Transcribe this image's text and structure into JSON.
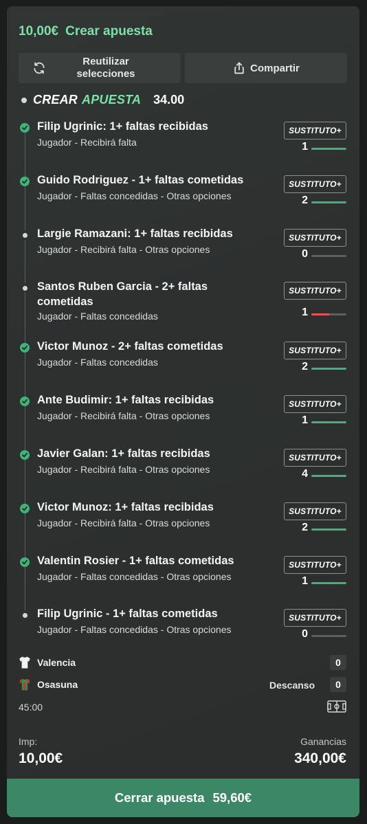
{
  "header": {
    "amount": "10,00€",
    "title": "Crear apuesta"
  },
  "actions": {
    "reuse_label_1": "Reutilizar",
    "reuse_label_2": "selecciones",
    "share_label": "Compartir"
  },
  "builder": {
    "title_part1": "CREAR",
    "title_part2": "APUESTA",
    "odds": "34.00"
  },
  "selections": [
    {
      "name": "Filip Ugrinic: 1+ faltas recibidas",
      "desc": "Jugador - Recibirá falta",
      "badge": "SUSTITUTO+",
      "count": "1",
      "progress": 1.0,
      "status": "won"
    },
    {
      "name": "Guido Rodriguez - 1+ faltas cometidas",
      "desc": "Jugador - Faltas concedidas - Otras opciones",
      "badge": "SUSTITUTO+",
      "count": "2",
      "progress": 1.0,
      "status": "won"
    },
    {
      "name": "Largie Ramazani: 1+ faltas recibidas",
      "desc": "Jugador - Recibirá falta - Otras opciones",
      "badge": "SUSTITUTO+",
      "count": "0",
      "progress": 0.0,
      "status": "pending"
    },
    {
      "name": "Santos Ruben Garcia - 2+ faltas cometidas",
      "desc": "Jugador - Faltas concedidas",
      "badge": "SUSTITUTO+",
      "count": "1",
      "progress": 0.5,
      "status": "pending"
    },
    {
      "name": "Victor Munoz - 2+ faltas cometidas",
      "desc": "Jugador - Faltas concedidas",
      "badge": "SUSTITUTO+",
      "count": "2",
      "progress": 1.0,
      "status": "won"
    },
    {
      "name": "Ante Budimir: 1+ faltas recibidas",
      "desc": "Jugador - Recibirá falta - Otras opciones",
      "badge": "SUSTITUTO+",
      "count": "1",
      "progress": 1.0,
      "status": "won"
    },
    {
      "name": "Javier Galan: 1+ faltas recibidas",
      "desc": "Jugador - Recibirá falta - Otras opciones",
      "badge": "SUSTITUTO+",
      "count": "4",
      "progress": 1.0,
      "status": "won"
    },
    {
      "name": "Victor Munoz: 1+ faltas recibidas",
      "desc": "Jugador - Recibirá falta - Otras opciones",
      "badge": "SUSTITUTO+",
      "count": "2",
      "progress": 1.0,
      "status": "won"
    },
    {
      "name": "Valentin Rosier - 1+ faltas cometidas",
      "desc": "Jugador - Faltas concedidas - Otras opciones",
      "badge": "SUSTITUTO+",
      "count": "1",
      "progress": 1.0,
      "status": "won"
    },
    {
      "name": "Filip Ugrinic - 1+ faltas cometidas",
      "desc": "Jugador - Faltas concedidas - Otras opciones",
      "badge": "SUSTITUTO+",
      "count": "0",
      "progress": 0.0,
      "status": "pending"
    }
  ],
  "match": {
    "home": {
      "name": "Valencia",
      "score": "0"
    },
    "away": {
      "name": "Osasuna",
      "score": "0"
    },
    "period": "Descanso",
    "clock": "45:00"
  },
  "stake": {
    "label": "Imp:",
    "value": "10,00€"
  },
  "winnings": {
    "label": "Ganancias",
    "value": "340,00€"
  },
  "cashout": {
    "label": "Cerrar apuesta",
    "amount": "59,60€"
  },
  "colors": {
    "accent": "#7ee0a8",
    "success": "#3fb37a",
    "danger": "#e05656",
    "button": "#3c8866"
  }
}
